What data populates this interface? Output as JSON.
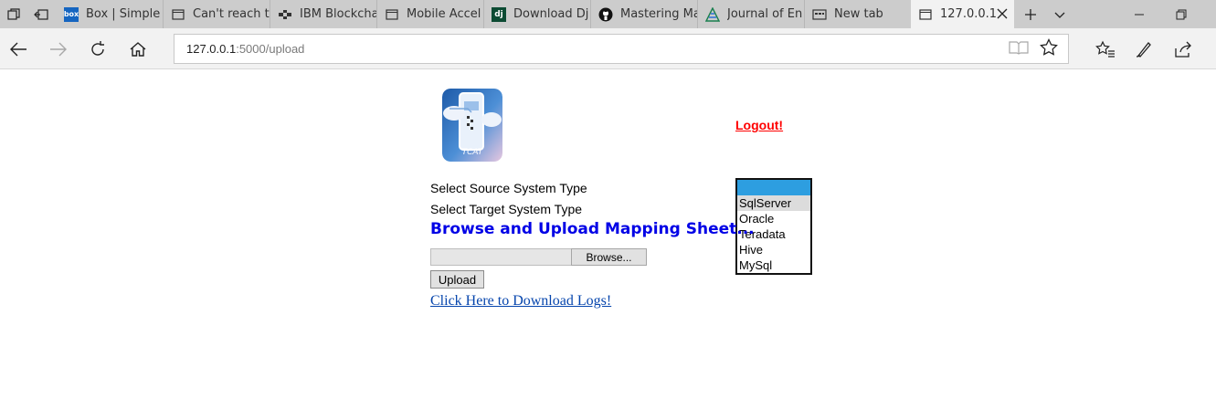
{
  "browser": {
    "tabs": [
      {
        "label": "Box | Simple",
        "icon": "box-logo-icon"
      },
      {
        "label": "Can't reach th",
        "icon": "page-icon"
      },
      {
        "label": "IBM Blockcha",
        "icon": "blockchain-icon"
      },
      {
        "label": "Mobile Accel",
        "icon": "page-icon"
      },
      {
        "label": "Download Dj",
        "icon": "django-icon"
      },
      {
        "label": "Mastering Ma",
        "icon": "github-icon"
      },
      {
        "label": "Journal of En",
        "icon": "journal-icon"
      },
      {
        "label": "New tab",
        "icon": "new-tab-icon"
      },
      {
        "label": "127.0.0.1",
        "icon": "page-icon",
        "active": true
      }
    ],
    "address": {
      "host": "127.0.0.1",
      "path": ":5000/upload"
    },
    "colors": {
      "tabstrip": "#cccccc",
      "toolbar": "#f2f2f2"
    }
  },
  "page": {
    "logo_text": "TCAT",
    "logout_label": "Logout!",
    "source_label": "Select Source System Type",
    "target_label": "Select Target System Type",
    "heading": "Browse and Upload Mapping Sheet...",
    "listbox": {
      "options": [
        "",
        "SqlServer",
        "Oracle",
        "Teradata",
        "Hive",
        "MySql"
      ],
      "selected_index": 0,
      "hover_index": 1
    },
    "browse_label": "Browse...",
    "upload_label": "Upload",
    "download_link": "Click Here to Download Logs!",
    "colors": {
      "heading": "#0000e6",
      "logout": "#ff0000",
      "link": "#0645ad",
      "selection": "#2d9ee0"
    }
  }
}
